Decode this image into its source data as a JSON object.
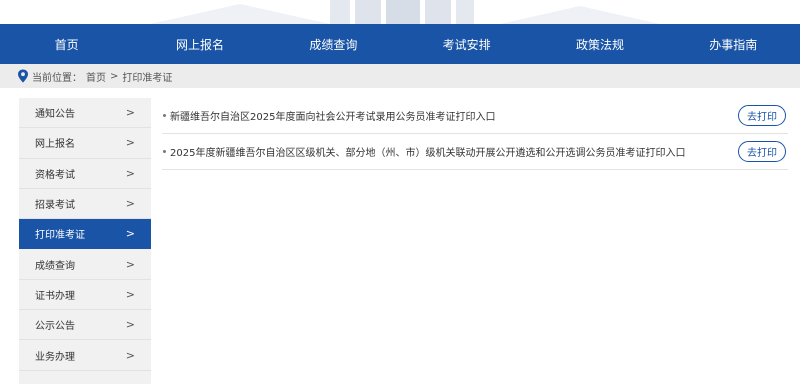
{
  "nav": {
    "items": [
      {
        "label": "首页"
      },
      {
        "label": "网上报名"
      },
      {
        "label": "成绩查询"
      },
      {
        "label": "考试安排"
      },
      {
        "label": "政策法规"
      },
      {
        "label": "办事指南"
      }
    ]
  },
  "breadcrumb": {
    "prefix": "当前位置：",
    "home": "首页",
    "separator": ">",
    "current": "打印准考证"
  },
  "sidebar": {
    "items": [
      {
        "label": "通知公告",
        "arrow": ">"
      },
      {
        "label": "网上报名",
        "arrow": ">"
      },
      {
        "label": "资格考试",
        "arrow": ">"
      },
      {
        "label": "招录考试",
        "arrow": ">"
      },
      {
        "label": "打印准考证",
        "arrow": ">"
      },
      {
        "label": "成绩查询",
        "arrow": ">"
      },
      {
        "label": "证书办理",
        "arrow": ">"
      },
      {
        "label": "公示公告",
        "arrow": ">"
      },
      {
        "label": "业务办理",
        "arrow": ">"
      }
    ],
    "active_index": 4
  },
  "content": {
    "rows": [
      {
        "title": "新疆维吾尔自治区2025年度面向社会公开考试录用公务员准考证打印入口",
        "button": "去打印"
      },
      {
        "title": "2025年度新疆维吾尔自治区区级机关、部分地（州、市）级机关联动开展公开遴选和公开选调公务员准考证打印入口",
        "button": "去打印"
      }
    ]
  },
  "colors": {
    "primary": "#1954a6",
    "breadcrumb_bg": "#ececec",
    "sidebar_bg": "#f1f1f1"
  },
  "icons": {
    "breadcrumb": "location-pin-icon",
    "sidebar_arrow": "chevron-right-icon"
  }
}
